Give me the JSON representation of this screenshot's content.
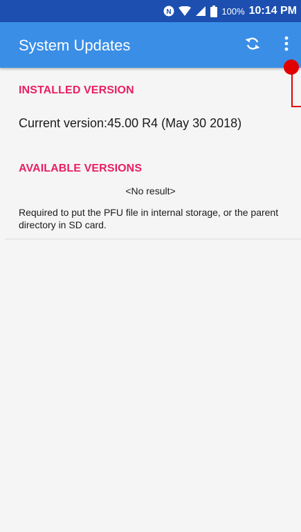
{
  "status_bar": {
    "battery_percent": "100%",
    "time": "10:14 PM",
    "icons": [
      "nfc-icon",
      "wifi-icon",
      "cellular-signal-icon",
      "battery-icon"
    ]
  },
  "app_bar": {
    "title": "System Updates",
    "refresh_icon": "refresh-icon",
    "more_icon": "more-vert-icon"
  },
  "installed": {
    "header": "INSTALLED VERSION",
    "current_version": "Current version:45.00 R4 (May 30 2018)"
  },
  "available": {
    "header": "AVAILABLE VERSIONS",
    "no_result": "<No result>",
    "hint": "Required to put the PFU file in internal storage, or the parent directory in SD card."
  },
  "colors": {
    "status_bar": "#1c4fb0",
    "app_bar": "#3a8ee6",
    "section_header": "#e91e63",
    "annotation": "#e00000",
    "background": "#f5f5f5"
  }
}
